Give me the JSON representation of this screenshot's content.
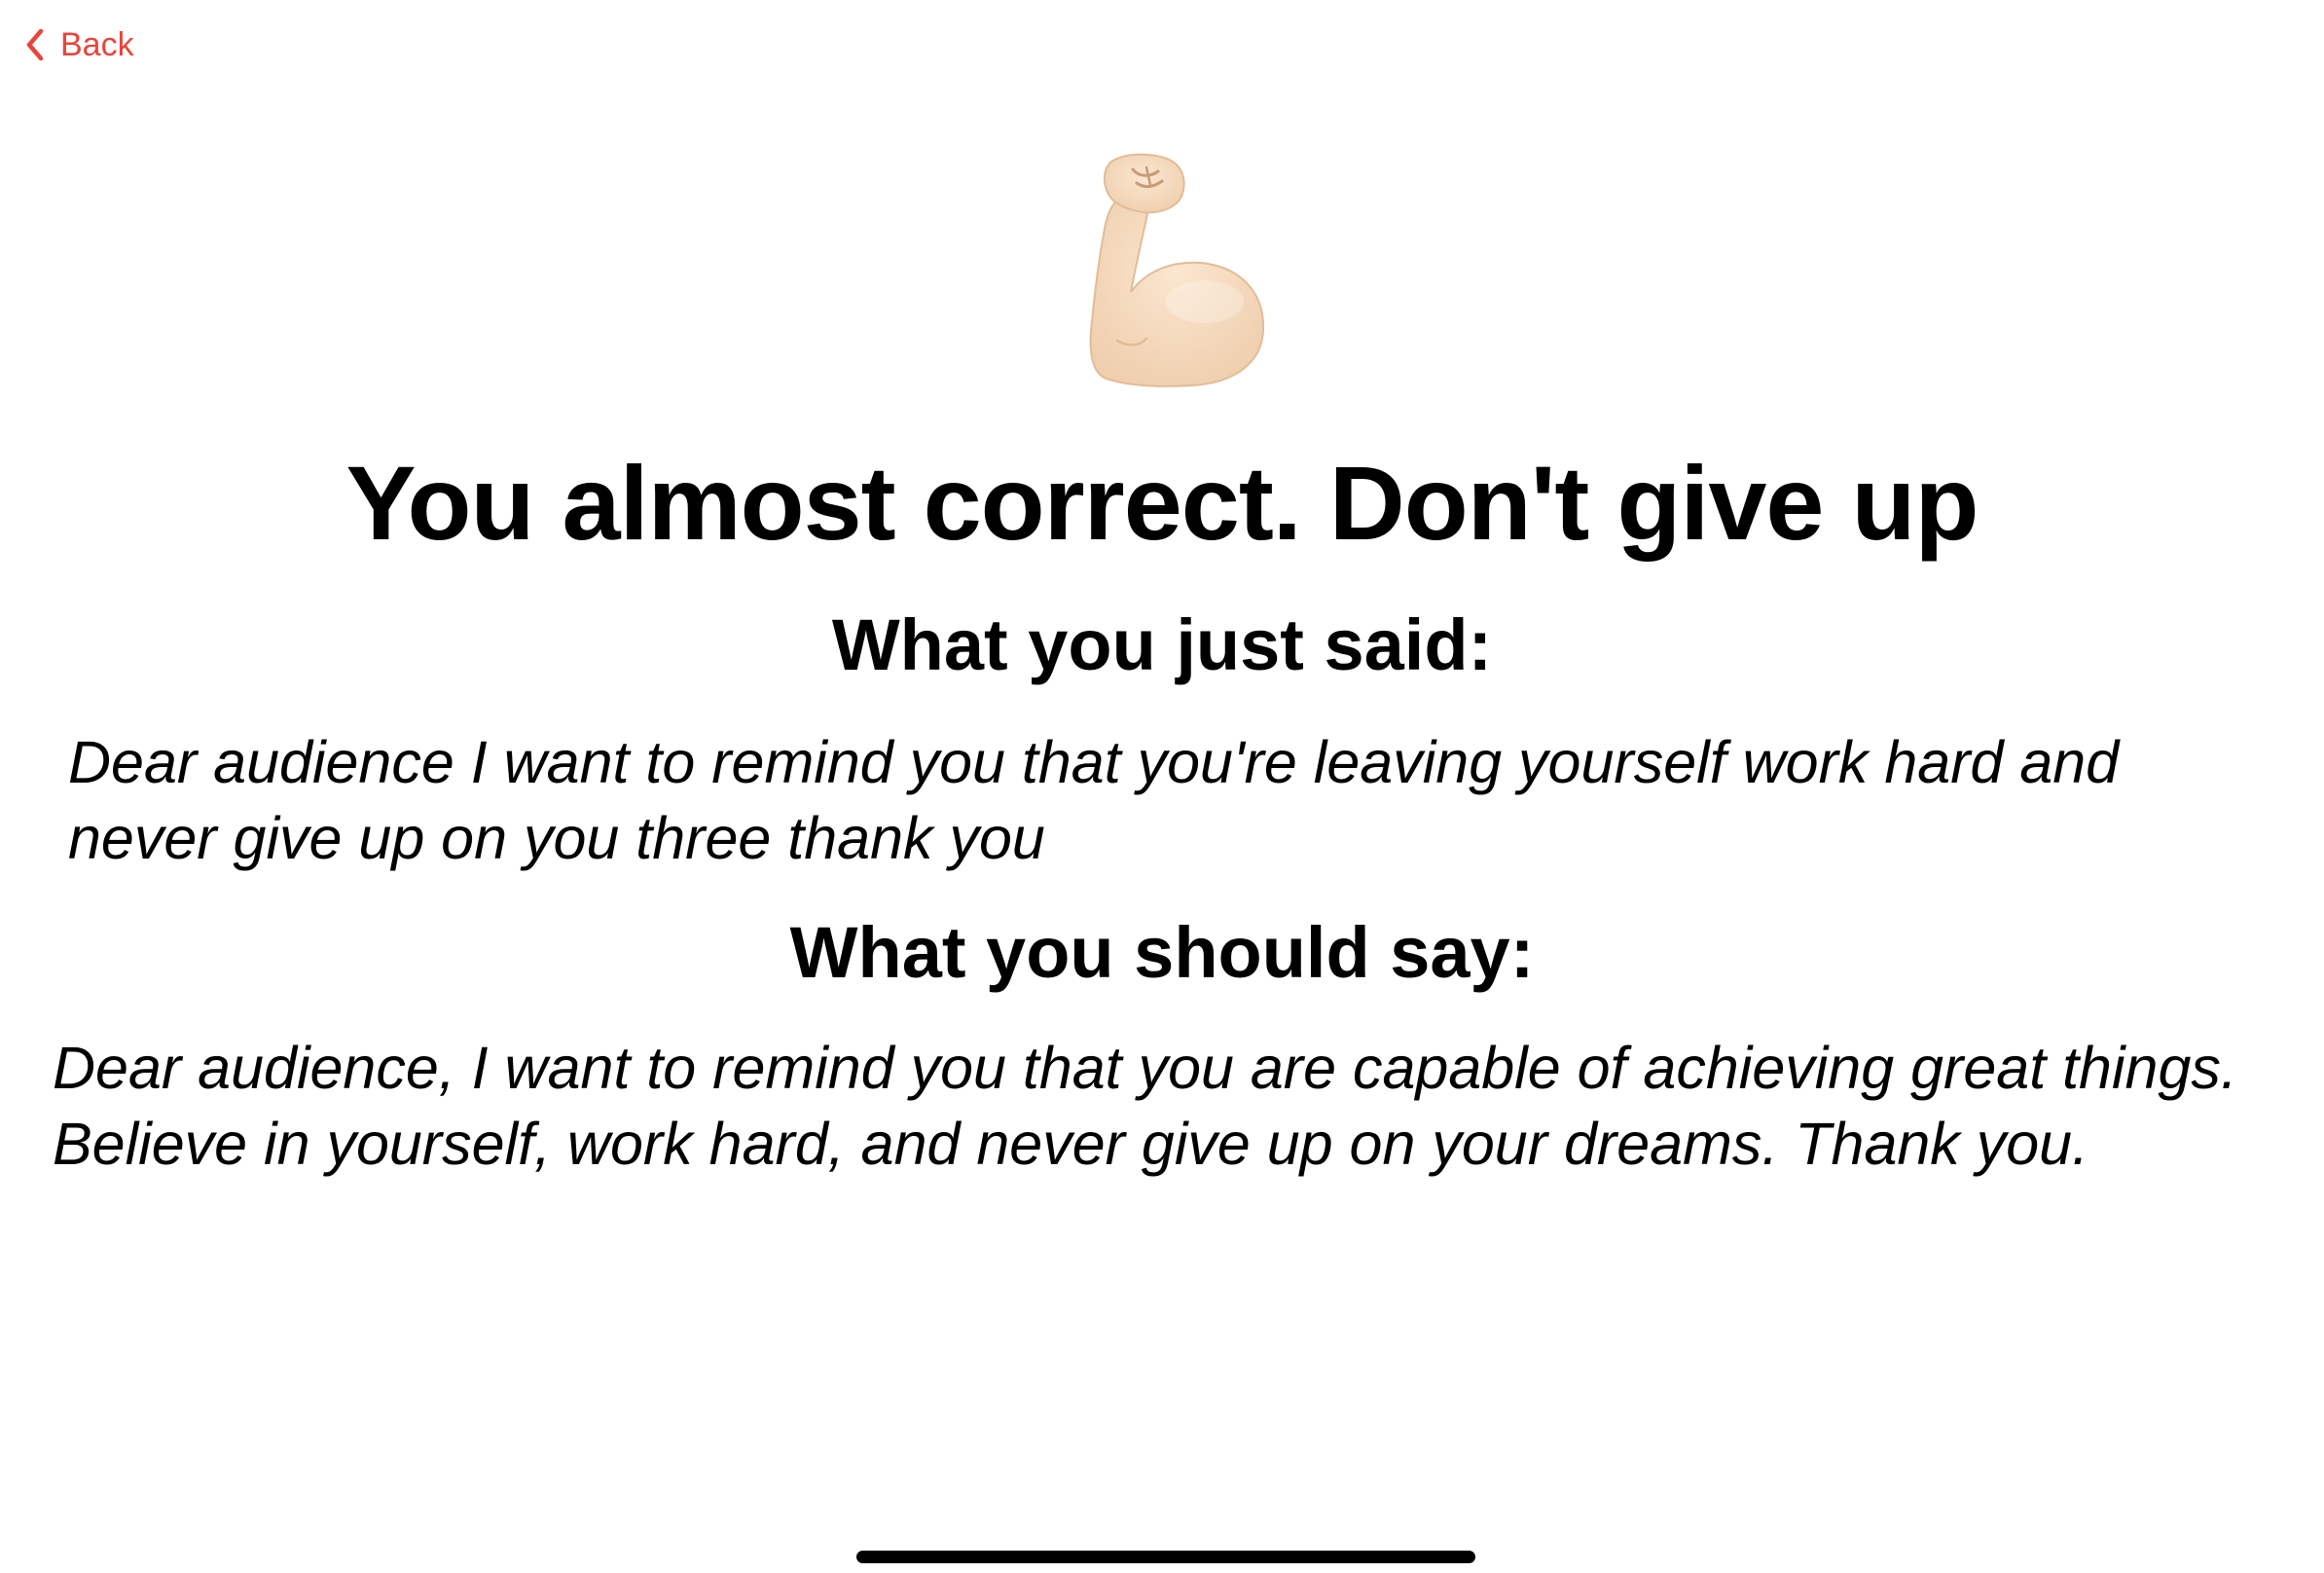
{
  "nav": {
    "back_label": "Back",
    "accent_color": "#e8453c"
  },
  "feedback": {
    "emoji": "flexed-biceps",
    "title": "You almost correct. Don't give up"
  },
  "said": {
    "heading": "What you just said:",
    "text": "Dear audience I want to remind you that you're leaving yourself work hard and never give up on you three thank you"
  },
  "should": {
    "heading": "What you should say:",
    "text": "Dear audience, I want to remind you that you are capable of achieving great things. Believe in yourself, work hard, and never give up on your dreams. Thank you."
  }
}
